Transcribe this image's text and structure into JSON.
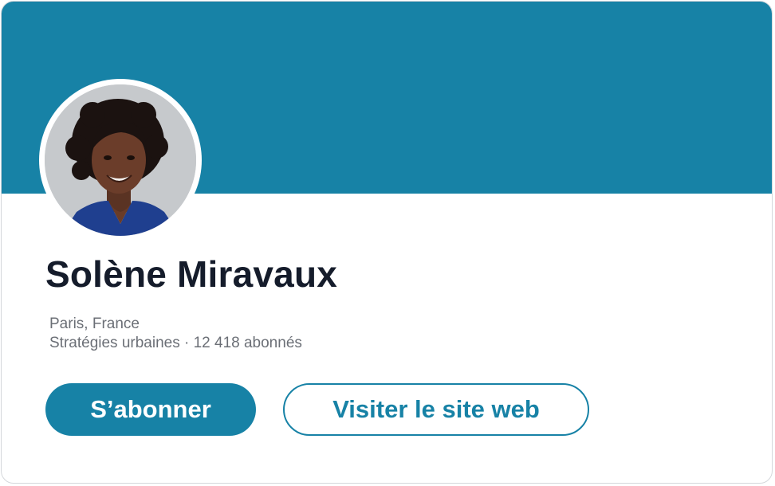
{
  "profile": {
    "name": "Solène Miravaux",
    "location": "Paris, France",
    "headline": "Stratégies urbaines · 12 418 abonnés",
    "avatar_alt": "Photo de profil"
  },
  "actions": {
    "subscribe_label": "S’abonner",
    "website_label": "Visiter le site web"
  },
  "colors": {
    "accent": "#1782a6",
    "name_text": "#151c2b",
    "meta_text": "#6b6f76"
  }
}
